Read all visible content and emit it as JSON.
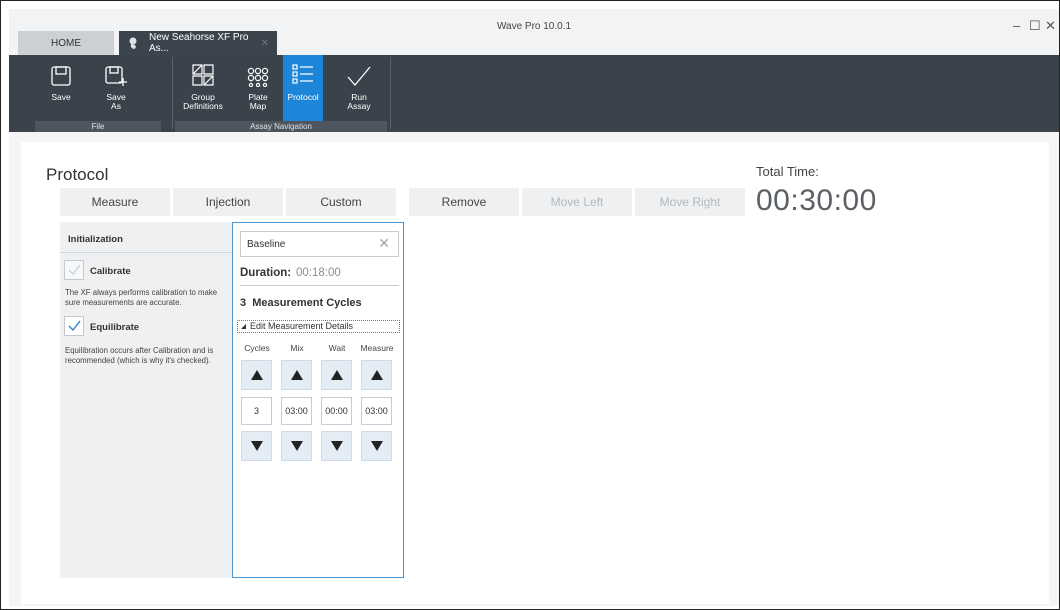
{
  "window": {
    "title": "Wave Pro 10.0.1",
    "minimize_glyph": "–",
    "maximize_glyph": "☐",
    "close_glyph": "✕"
  },
  "tabs": [
    {
      "label": "HOME"
    },
    {
      "label": "New Seahorse XF Pro As...",
      "icon": "seahorse-icon",
      "close_glyph": "✕"
    }
  ],
  "ribbon": {
    "groups": [
      {
        "label": "File"
      },
      {
        "label": "Assay Navigation"
      }
    ],
    "buttons": [
      {
        "label": "Save",
        "icon": "save-icon"
      },
      {
        "label": "Save\nAs",
        "icon": "save-as-icon"
      },
      {
        "label": "Group\nDefinitions",
        "icon": "group-definitions-icon"
      },
      {
        "label": "Plate\nMap",
        "icon": "plate-map-icon"
      },
      {
        "label": "Protocol",
        "icon": "protocol-icon",
        "active": true
      },
      {
        "label": "Run\nAssay",
        "icon": "run-assay-icon"
      }
    ]
  },
  "page": {
    "title": "Protocol",
    "total_time_label": "Total Time:",
    "total_time_value": "00:30:00"
  },
  "toolbar": {
    "measure": "Measure",
    "injection": "Injection",
    "custom": "Custom",
    "remove": "Remove",
    "move_left": "Move Left",
    "move_right": "Move Right"
  },
  "init": {
    "title": "Initialization",
    "calibrate_label": "Calibrate",
    "calibrate_note": "The XF always performs calibration to make sure measurements are accurate.",
    "equilibrate_label": "Equilibrate",
    "equilibrate_note": "Equilibration occurs after Calibration and is recommended (which is why it's checked)."
  },
  "step": {
    "name": "Baseline",
    "duration_label": "Duration:",
    "duration_value": "00:18:00",
    "cycles_title": "3  Measurement Cycles",
    "edit_details": "Edit Measurement Details",
    "columns": [
      {
        "header": "Cycles",
        "value": "3"
      },
      {
        "header": "Mix",
        "value": "03:00"
      },
      {
        "header": "Wait",
        "value": "00:00"
      },
      {
        "header": "Measure",
        "value": "03:00"
      }
    ]
  },
  "colors": {
    "ribbon_bg": "#3a434b",
    "active_button": "#1e86d8",
    "panel_border": "#4a97d4"
  }
}
